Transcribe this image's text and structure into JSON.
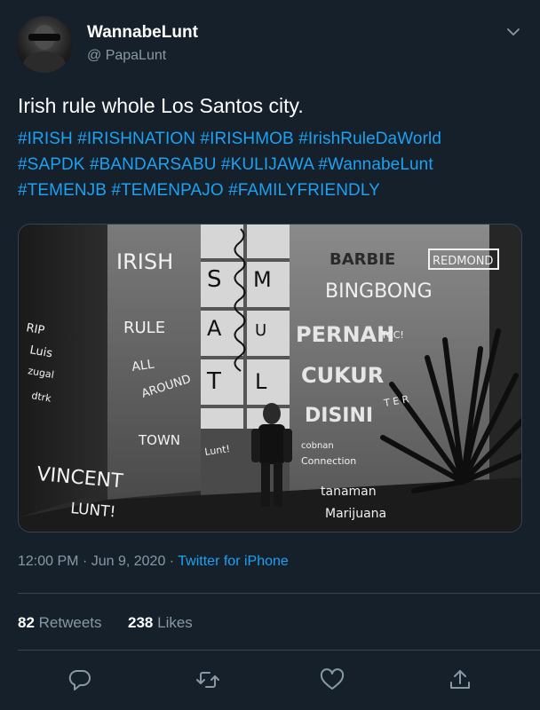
{
  "author": {
    "display_name": "WannabeLunt",
    "handle": "@ PapaLunt"
  },
  "tweet": {
    "text": "Irish rule whole Los Santos city.",
    "hashtag_lines": [
      "#IRISH #IRISHNATION #IRISHMOB #IrishRuleDaWorld",
      "#SAPDK #BANDARSABU #KULIJAWA #WannabeLunt",
      "#TEMENJB #TEMENPAJO #FAMILYFRIENDLY"
    ]
  },
  "media": {
    "graffiti": {
      "rip": "RIP",
      "luis": "Luis",
      "zugal": "zugal",
      "dtrk": "dtrk",
      "irish": "IRISH",
      "rule": "RULE",
      "all": "ALL",
      "around": "AROUND",
      "town": "TOWN",
      "vincent": "VINCENT",
      "lunt_excl": "LUNT!",
      "lunt_small": "Lunt!",
      "s": "S",
      "m": "M",
      "a": "A",
      "u": "U",
      "t": "T",
      "l": "L",
      "barbie": "BARBIE",
      "redmond": "REDMOND",
      "bingbong": "BINGBONG",
      "pernah": "PERNAH",
      "tcc": "TCC!",
      "cukur": "CUKUR",
      "disini": "DISINI",
      "ter": "T E R",
      "cobnan": "cobnan",
      "connection": "Connection",
      "tanaman": "tanaman",
      "marijuana": "Marijuana"
    }
  },
  "meta": {
    "time": "12:00 PM",
    "date": "Jun 9, 2020",
    "separator": "·",
    "source": "Twitter for iPhone"
  },
  "stats": {
    "retweets_count": "82",
    "retweets_label": "Retweets",
    "likes_count": "238",
    "likes_label": "Likes"
  },
  "colors": {
    "background": "#15202b",
    "accent": "#1da1f2",
    "secondary_text": "#8899a6",
    "divider": "#38444d"
  },
  "icons": {
    "chevron": "chevron-down-icon",
    "reply": "reply-icon",
    "retweet": "retweet-icon",
    "like": "heart-icon",
    "share": "share-icon"
  }
}
